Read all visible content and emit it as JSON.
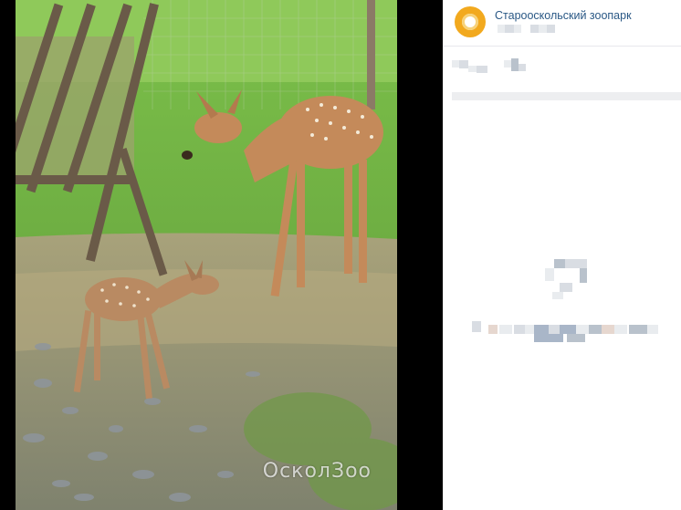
{
  "post": {
    "author_name": "Старооскольский зоопарк",
    "watermark_text": "ОсколЗоо"
  },
  "icons": {
    "avatar": "zoo-logo-icon"
  },
  "colors": {
    "link": "#2a5885",
    "avatar_bg": "#f2a91e"
  }
}
